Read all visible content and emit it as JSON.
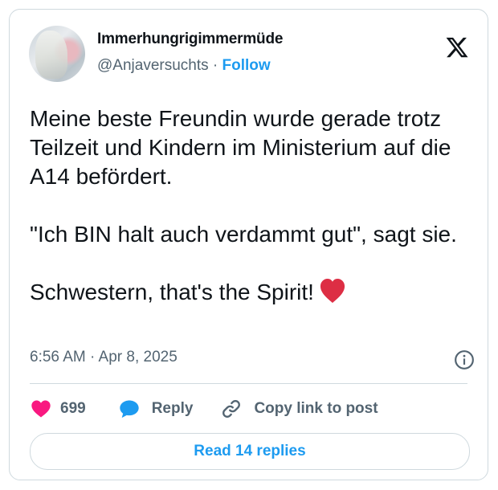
{
  "author": {
    "display_name": "Immerhungrigimmermüde",
    "handle": "@Anjaversuchts",
    "separator": "·",
    "follow_label": "Follow"
  },
  "tweet": {
    "paragraphs": [
      "Meine beste Freundin wurde gerade trotz Teilzeit und Kindern im Ministerium auf die A14 befördert.",
      "\"Ich BIN halt auch verdammt gut\", sagt sie.",
      "Schwestern, that's the Spirit!"
    ],
    "emoji": "red-heart",
    "timestamp": "6:56 AM · Apr 8, 2025"
  },
  "actions": {
    "like_count": "699",
    "reply_label": "Reply",
    "copy_label": "Copy link to post"
  },
  "read_replies_label": "Read 14 replies",
  "icons": [
    "x-logo-icon",
    "info-icon",
    "heart-icon",
    "reply-bubble-icon",
    "link-icon",
    "red-heart-emoji"
  ],
  "colors": {
    "accent": "#1d9bf0",
    "like": "#f91880",
    "text": "#0f1419",
    "secondary": "#536471",
    "border": "#cfd9de"
  }
}
